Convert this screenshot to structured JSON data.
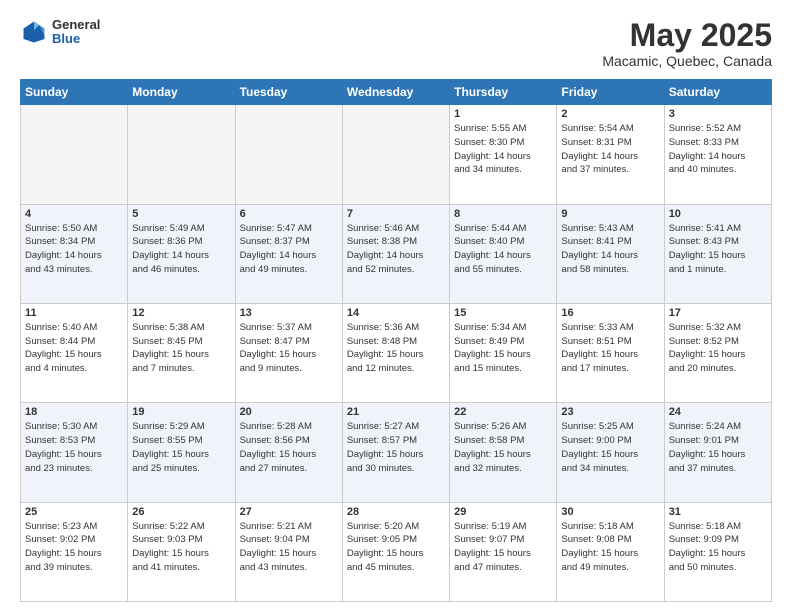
{
  "logo": {
    "general": "General",
    "blue": "Blue"
  },
  "header": {
    "title": "May 2025",
    "subtitle": "Macamic, Quebec, Canada"
  },
  "calendar": {
    "days": [
      "Sunday",
      "Monday",
      "Tuesday",
      "Wednesday",
      "Thursday",
      "Friday",
      "Saturday"
    ],
    "rows": [
      [
        {
          "day": "",
          "content": "",
          "empty": true
        },
        {
          "day": "",
          "content": "",
          "empty": true
        },
        {
          "day": "",
          "content": "",
          "empty": true
        },
        {
          "day": "",
          "content": "",
          "empty": true
        },
        {
          "day": "1",
          "content": "Sunrise: 5:55 AM\nSunset: 8:30 PM\nDaylight: 14 hours\nand 34 minutes."
        },
        {
          "day": "2",
          "content": "Sunrise: 5:54 AM\nSunset: 8:31 PM\nDaylight: 14 hours\nand 37 minutes."
        },
        {
          "day": "3",
          "content": "Sunrise: 5:52 AM\nSunset: 8:33 PM\nDaylight: 14 hours\nand 40 minutes."
        }
      ],
      [
        {
          "day": "4",
          "content": "Sunrise: 5:50 AM\nSunset: 8:34 PM\nDaylight: 14 hours\nand 43 minutes."
        },
        {
          "day": "5",
          "content": "Sunrise: 5:49 AM\nSunset: 8:36 PM\nDaylight: 14 hours\nand 46 minutes."
        },
        {
          "day": "6",
          "content": "Sunrise: 5:47 AM\nSunset: 8:37 PM\nDaylight: 14 hours\nand 49 minutes."
        },
        {
          "day": "7",
          "content": "Sunrise: 5:46 AM\nSunset: 8:38 PM\nDaylight: 14 hours\nand 52 minutes."
        },
        {
          "day": "8",
          "content": "Sunrise: 5:44 AM\nSunset: 8:40 PM\nDaylight: 14 hours\nand 55 minutes."
        },
        {
          "day": "9",
          "content": "Sunrise: 5:43 AM\nSunset: 8:41 PM\nDaylight: 14 hours\nand 58 minutes."
        },
        {
          "day": "10",
          "content": "Sunrise: 5:41 AM\nSunset: 8:43 PM\nDaylight: 15 hours\nand 1 minute."
        }
      ],
      [
        {
          "day": "11",
          "content": "Sunrise: 5:40 AM\nSunset: 8:44 PM\nDaylight: 15 hours\nand 4 minutes."
        },
        {
          "day": "12",
          "content": "Sunrise: 5:38 AM\nSunset: 8:45 PM\nDaylight: 15 hours\nand 7 minutes."
        },
        {
          "day": "13",
          "content": "Sunrise: 5:37 AM\nSunset: 8:47 PM\nDaylight: 15 hours\nand 9 minutes."
        },
        {
          "day": "14",
          "content": "Sunrise: 5:36 AM\nSunset: 8:48 PM\nDaylight: 15 hours\nand 12 minutes."
        },
        {
          "day": "15",
          "content": "Sunrise: 5:34 AM\nSunset: 8:49 PM\nDaylight: 15 hours\nand 15 minutes."
        },
        {
          "day": "16",
          "content": "Sunrise: 5:33 AM\nSunset: 8:51 PM\nDaylight: 15 hours\nand 17 minutes."
        },
        {
          "day": "17",
          "content": "Sunrise: 5:32 AM\nSunset: 8:52 PM\nDaylight: 15 hours\nand 20 minutes."
        }
      ],
      [
        {
          "day": "18",
          "content": "Sunrise: 5:30 AM\nSunset: 8:53 PM\nDaylight: 15 hours\nand 23 minutes."
        },
        {
          "day": "19",
          "content": "Sunrise: 5:29 AM\nSunset: 8:55 PM\nDaylight: 15 hours\nand 25 minutes."
        },
        {
          "day": "20",
          "content": "Sunrise: 5:28 AM\nSunset: 8:56 PM\nDaylight: 15 hours\nand 27 minutes."
        },
        {
          "day": "21",
          "content": "Sunrise: 5:27 AM\nSunset: 8:57 PM\nDaylight: 15 hours\nand 30 minutes."
        },
        {
          "day": "22",
          "content": "Sunrise: 5:26 AM\nSunset: 8:58 PM\nDaylight: 15 hours\nand 32 minutes."
        },
        {
          "day": "23",
          "content": "Sunrise: 5:25 AM\nSunset: 9:00 PM\nDaylight: 15 hours\nand 34 minutes."
        },
        {
          "day": "24",
          "content": "Sunrise: 5:24 AM\nSunset: 9:01 PM\nDaylight: 15 hours\nand 37 minutes."
        }
      ],
      [
        {
          "day": "25",
          "content": "Sunrise: 5:23 AM\nSunset: 9:02 PM\nDaylight: 15 hours\nand 39 minutes."
        },
        {
          "day": "26",
          "content": "Sunrise: 5:22 AM\nSunset: 9:03 PM\nDaylight: 15 hours\nand 41 minutes."
        },
        {
          "day": "27",
          "content": "Sunrise: 5:21 AM\nSunset: 9:04 PM\nDaylight: 15 hours\nand 43 minutes."
        },
        {
          "day": "28",
          "content": "Sunrise: 5:20 AM\nSunset: 9:05 PM\nDaylight: 15 hours\nand 45 minutes."
        },
        {
          "day": "29",
          "content": "Sunrise: 5:19 AM\nSunset: 9:07 PM\nDaylight: 15 hours\nand 47 minutes."
        },
        {
          "day": "30",
          "content": "Sunrise: 5:18 AM\nSunset: 9:08 PM\nDaylight: 15 hours\nand 49 minutes."
        },
        {
          "day": "31",
          "content": "Sunrise: 5:18 AM\nSunset: 9:09 PM\nDaylight: 15 hours\nand 50 minutes."
        }
      ]
    ]
  }
}
